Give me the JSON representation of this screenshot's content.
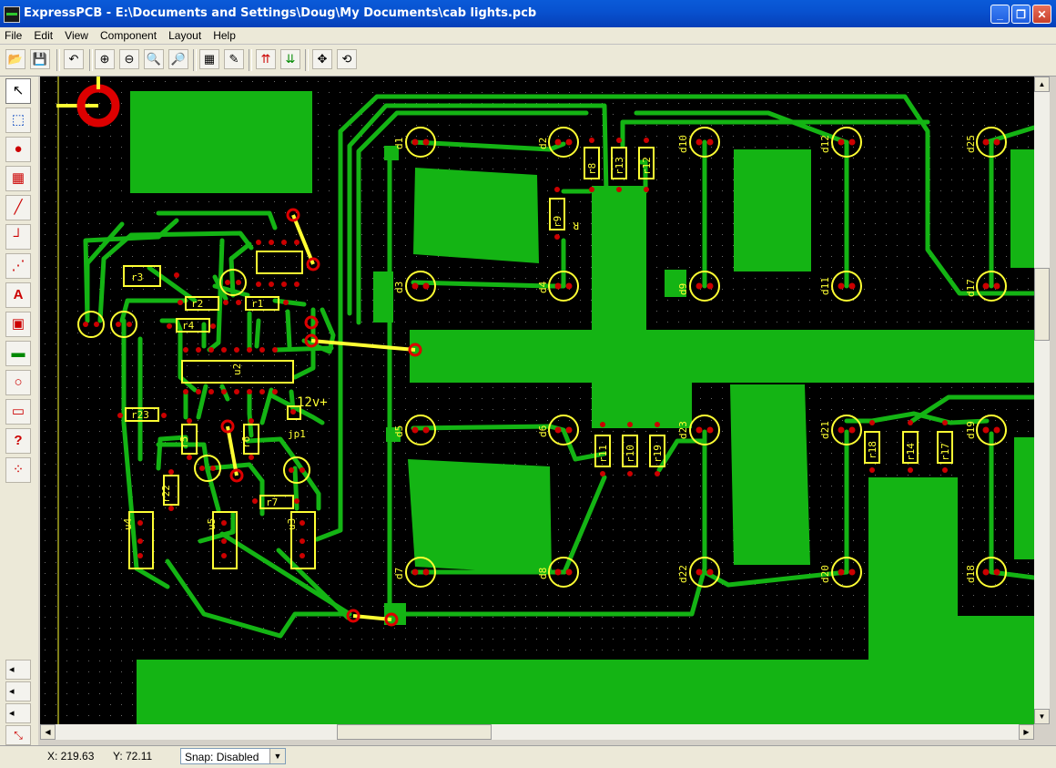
{
  "window": {
    "title": "ExpressPCB - E:\\Documents and Settings\\Doug\\My Documents\\cab lights.pcb",
    "minimize_glyph": "_",
    "maximize_glyph": "❐",
    "close_glyph": "✕"
  },
  "menu": [
    "File",
    "Edit",
    "View",
    "Component",
    "Layout",
    "Help"
  ],
  "toolbar": {
    "icons": [
      "open-icon",
      "save-icon",
      "undo-icon",
      "zoom-in-icon",
      "zoom-out-icon",
      "zoom-window-icon",
      "zoom-fit-icon",
      "properties-icon",
      "rename-icon",
      "top-layer-icon",
      "bottom-layer-icon",
      "move-icon",
      "rotate-icon"
    ],
    "glyphs": {
      "open": "📂",
      "save": "💾",
      "undo": "↶",
      "zoom_in": "⊕",
      "zoom_out": "⊖",
      "zoom_window": "🔍",
      "zoom_fit": "🔎",
      "properties": "▦",
      "rename": "✎",
      "top_layer": "⇈",
      "bottom_layer": "⇊",
      "move": "✥",
      "rotate": "⟲"
    }
  },
  "left_tools": {
    "glyphs": {
      "select": "↖",
      "zoom_select": "⬚",
      "pad": "●",
      "component": "▦",
      "trace": "╱",
      "corner": "┘",
      "connect": "⋰",
      "text": "A",
      "copy": "▣",
      "fill": "▬",
      "circle": "○",
      "rect": "▭",
      "query": "?",
      "net": "⁘",
      "layer_a": "◂",
      "layer_b": "◂",
      "layer_c": "◂",
      "ratsnest": "⤡"
    }
  },
  "pcb": {
    "colors": {
      "copper": "#14b414",
      "silk": "#ffff33",
      "pad": "#cc0000",
      "via": "#dd0000",
      "jumper": "#ffff33",
      "board": "#000000"
    },
    "silk_labels": [
      "d1",
      "d2",
      "d3",
      "d4",
      "d5",
      "d6",
      "d7",
      "d8",
      "d10",
      "d11",
      "d12",
      "d17",
      "d18",
      "d19",
      "d20",
      "d21",
      "d22",
      "d23",
      "d25",
      "d9",
      "r1",
      "r2",
      "r3",
      "r4",
      "r5",
      "r6",
      "r7",
      "r8",
      "r9",
      "r10",
      "r11",
      "r12",
      "r13",
      "r14",
      "r17",
      "r18",
      "r19",
      "r22",
      "r23",
      "u2",
      "u3",
      "u4",
      "u5",
      "12v+",
      "jp1",
      "R"
    ]
  },
  "scrollbars": {
    "up": "▲",
    "down": "▼",
    "left": "◀",
    "right": "▶"
  },
  "status": {
    "x": "X: 219.63",
    "y": "Y: 72.11",
    "snap": "Snap: Disabled",
    "dropdown_glyph": "▼"
  }
}
